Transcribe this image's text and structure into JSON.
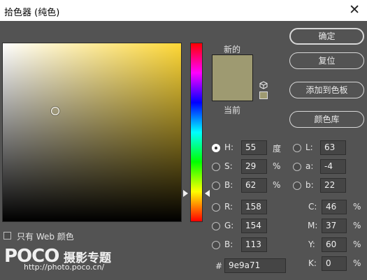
{
  "window": {
    "title": "拾色器 (纯色)",
    "close_glyph": "✕"
  },
  "swatch": {
    "new_label": "新的",
    "current_label": "当前",
    "new_color": "#9e9a71",
    "current_color": "#9e9a71"
  },
  "buttons": {
    "ok": "确定",
    "reset": "复位",
    "add_to_swatches": "添加到色板",
    "color_libraries": "颜色库"
  },
  "web_colors": {
    "label": "只有 Web 颜色",
    "checked": false
  },
  "hsb": [
    {
      "label": "H:",
      "value": "55",
      "unit": "度",
      "selected": true
    },
    {
      "label": "S:",
      "value": "29",
      "unit": "%",
      "selected": false
    },
    {
      "label": "B:",
      "value": "62",
      "unit": "%",
      "selected": false
    }
  ],
  "rgb": [
    {
      "label": "R:",
      "value": "158"
    },
    {
      "label": "G:",
      "value": "154"
    },
    {
      "label": "B:",
      "value": "113"
    }
  ],
  "lab": [
    {
      "label": "L:",
      "value": "63"
    },
    {
      "label": "a:",
      "value": "-4"
    },
    {
      "label": "b:",
      "value": "22"
    }
  ],
  "cmyk": [
    {
      "label": "C:",
      "value": "46",
      "unit": "%"
    },
    {
      "label": "M:",
      "value": "37",
      "unit": "%"
    },
    {
      "label": "Y:",
      "value": "60",
      "unit": "%"
    },
    {
      "label": "K:",
      "value": "0",
      "unit": "%"
    }
  ],
  "hex": {
    "label": "#",
    "value": "9e9a71"
  },
  "watermark": {
    "brand": "POCO",
    "title": "摄影专题",
    "url": "http://photo.poco.cn/"
  }
}
